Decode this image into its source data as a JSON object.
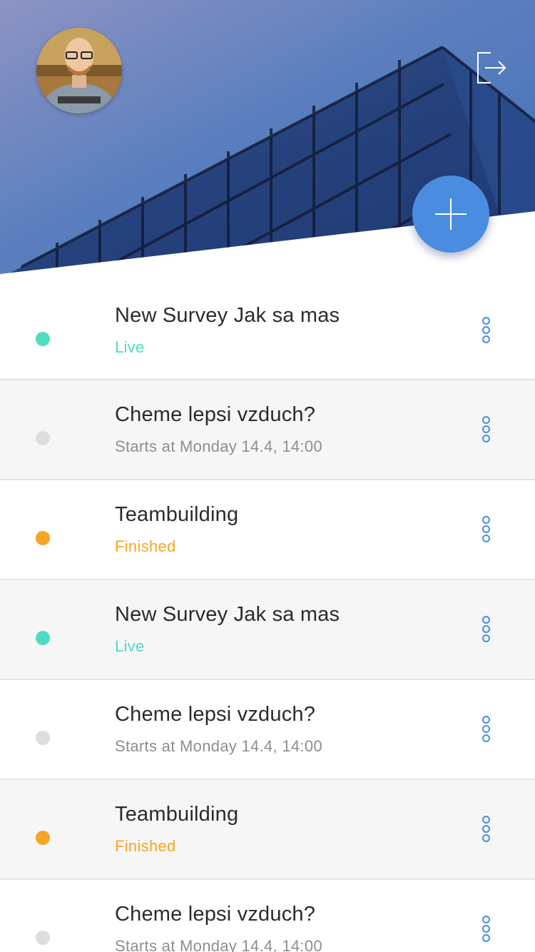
{
  "colors": {
    "accent": "#4a8de0",
    "live": "#4dddc0",
    "finished": "#f5a623",
    "scheduled": "#dddddd",
    "scheduled_text": "#8e8e8e"
  },
  "header": {
    "avatar_alt": "User avatar",
    "logout_icon": "logout-icon",
    "fab_icon": "plus-icon"
  },
  "surveys": [
    {
      "title": "New Survey Jak sa mas",
      "status": "Live",
      "state": "live"
    },
    {
      "title": "Cheme lepsi vzduch?",
      "status": "Starts at Monday 14.4, 14:00",
      "state": "scheduled"
    },
    {
      "title": "Teambuilding",
      "status": "Finished",
      "state": "finished"
    },
    {
      "title": "New Survey Jak sa mas",
      "status": "Live",
      "state": "live"
    },
    {
      "title": "Cheme lepsi vzduch?",
      "status": "Starts at Monday 14.4, 14:00",
      "state": "scheduled"
    },
    {
      "title": "Teambuilding",
      "status": "Finished",
      "state": "finished"
    },
    {
      "title": "Cheme lepsi vzduch?",
      "status": "Starts at Monday 14.4, 14:00",
      "state": "scheduled"
    }
  ]
}
